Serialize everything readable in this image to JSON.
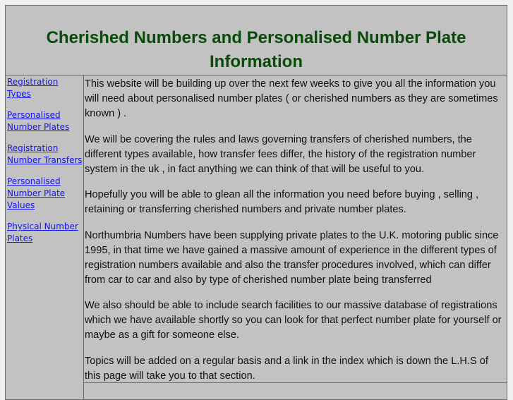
{
  "header": {
    "title": "Cherished Numbers and Personalised Number Plate Information"
  },
  "sidebar": {
    "items": [
      {
        "label": "Registration Types"
      },
      {
        "label": "Personalised Number Plates"
      },
      {
        "label": "Registration Number Transfers"
      },
      {
        "label": "Personalised Number Plate Values"
      },
      {
        "label": "Physical Number Plates"
      }
    ]
  },
  "main": {
    "paragraphs": [
      "This website will be building up over the next few weeks to give you all the information you will need about personalised number plates ( or cherished numbers as they are sometimes known ) .",
      "We will be covering the rules and laws governing transfers of cherished numbers, the different types available, how transfer fees differ, the history of the registration number system in the uk , in fact anything we can think of that will be useful to you.",
      "Hopefully you will be able to glean all the information you need before buying , selling , retaining or transferring  cherished numbers and private number plates.",
      "Northumbria Numbers have been supplying private plates to the U.K. motoring public since 1995, in that time we have gained a massive amount of experience in the different types of registration numbers available and also the transfer procedures involved, which can differ from car to car and also by type of cherished number plate being transferred",
      "We also should be able to include search facilities to our massive database of registrations which we have available shortly so you can look for that perfect number plate for yourself or maybe as a gift for someone else.",
      "Topics will be added on a regular basis and a link in the index which is down the L.H.S of this page will take you to that section."
    ]
  },
  "colors": {
    "page_background": "#efefef",
    "table_background": "#c2c2c2",
    "title_color": "#0a4a0a",
    "link_color": "#1515ee",
    "border_color": "#6b6b6b"
  }
}
